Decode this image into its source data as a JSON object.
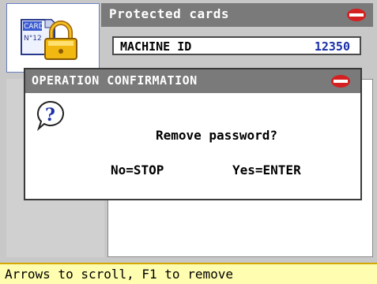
{
  "header": {
    "title": "Protected cards",
    "card_icon_label_top": "CARD",
    "card_icon_label_bottom": "N°12"
  },
  "machine": {
    "label": "MACHINE ID",
    "value": "12350"
  },
  "dialog": {
    "title": "OPERATION CONFIRMATION",
    "message": "Remove password?",
    "no_option": "No=STOP",
    "yes_option": "Yes=ENTER",
    "icon": "question-icon"
  },
  "status_bar": {
    "text": "Arrows to scroll, F1 to remove"
  },
  "colors": {
    "title_bar": "#7a7a7a",
    "machine_id_value": "#1a2fa8",
    "status_bar_bg": "#fffdb0",
    "logo_red": "#d42020"
  }
}
